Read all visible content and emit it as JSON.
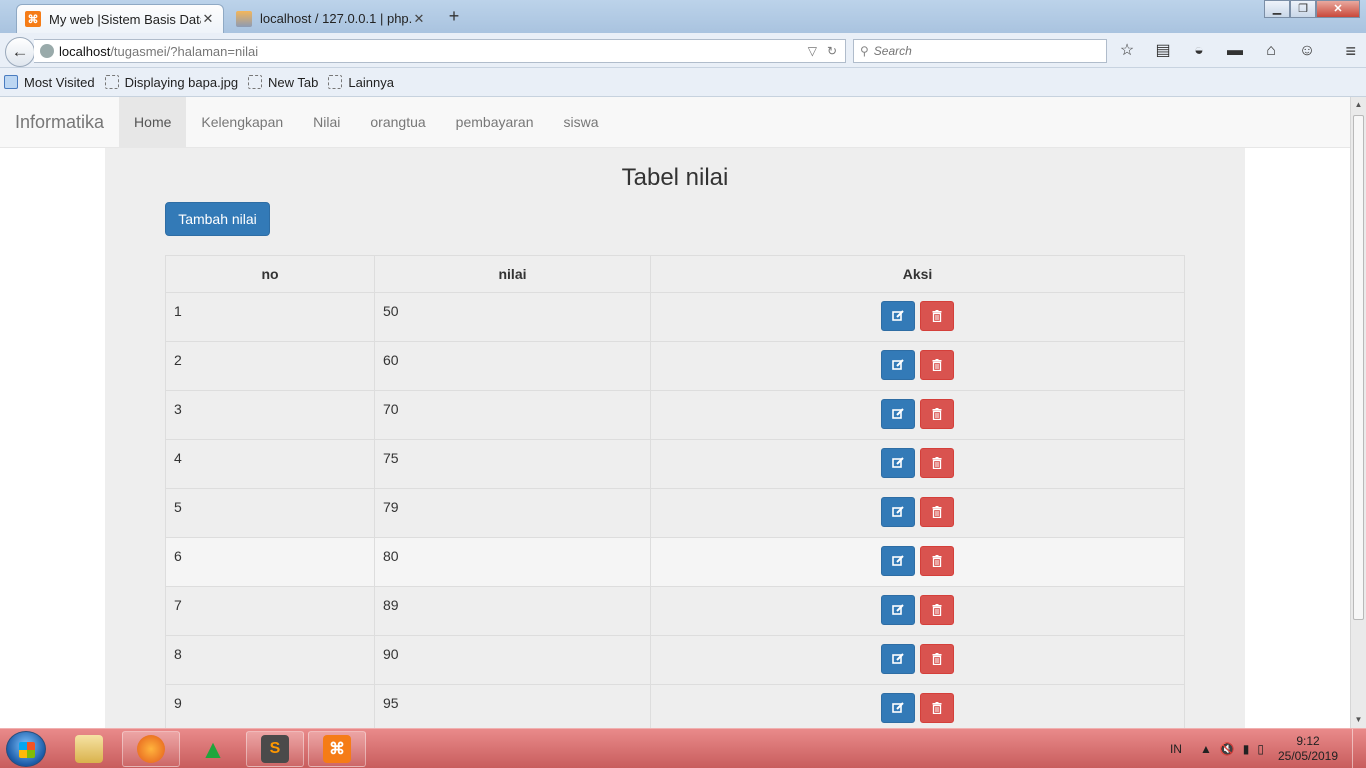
{
  "browser": {
    "tabs": [
      {
        "title": "My web |Sistem Basis Data|",
        "active": true
      },
      {
        "title": "localhost / 127.0.0.1 | php...",
        "active": false
      }
    ],
    "new_tab_symbol": "+",
    "url_host": "localhost",
    "url_path": "/tugasmei/?halaman=nilai",
    "search_placeholder": "Search",
    "bookmarks": [
      "Most Visited",
      "Displaying bapa.jpg",
      "New Tab",
      "Lainnya"
    ]
  },
  "site": {
    "brand": "Informatika",
    "nav": [
      "Home",
      "Kelengkapan",
      "Nilai",
      "orangtua",
      "pembayaran",
      "siswa"
    ],
    "active_nav": "Home",
    "heading": "Tabel nilai",
    "add_button": "Tambah nilai"
  },
  "table": {
    "columns": [
      "no",
      "nilai",
      "Aksi"
    ],
    "rows": [
      {
        "no": "1",
        "nilai": "50"
      },
      {
        "no": "2",
        "nilai": "60"
      },
      {
        "no": "3",
        "nilai": "70"
      },
      {
        "no": "4",
        "nilai": "75"
      },
      {
        "no": "5",
        "nilai": "79"
      },
      {
        "no": "6",
        "nilai": "80"
      },
      {
        "no": "7",
        "nilai": "89"
      },
      {
        "no": "8",
        "nilai": "90"
      },
      {
        "no": "9",
        "nilai": "95"
      },
      {
        "no": "",
        "nilai": ""
      }
    ],
    "hover_row": 6
  },
  "colors": {
    "primary": "#337ab7",
    "danger": "#d9534f",
    "taskbar": "#c85d5d"
  },
  "taskbar": {
    "language": "IN",
    "time": "9:12",
    "date": "25/05/2019"
  }
}
